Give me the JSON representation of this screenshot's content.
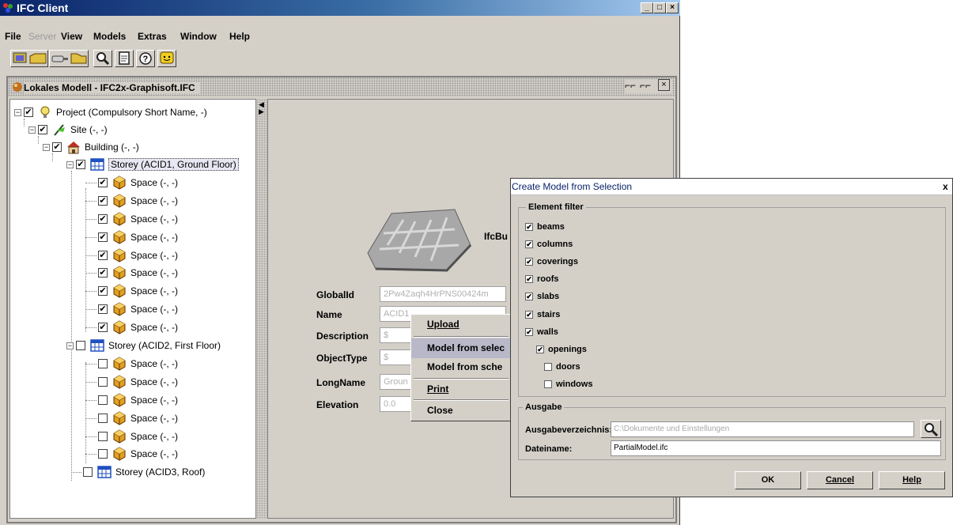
{
  "app": {
    "title": "IFC Client"
  },
  "menubar": [
    {
      "label": "File",
      "disabled": false
    },
    {
      "label": "Server",
      "disabled": true
    },
    {
      "label": "View",
      "disabled": false
    },
    {
      "label": "Models",
      "disabled": false
    },
    {
      "label": "Extras",
      "disabled": false
    },
    {
      "label": "Window",
      "disabled": false
    },
    {
      "label": "Help",
      "disabled": false
    }
  ],
  "toolbar": {
    "buttons": [
      "open-model-icon",
      "connect-icon",
      "search-icon",
      "document-icon",
      "help-icon",
      "chat-icon"
    ]
  },
  "frame": {
    "title": "Lokales Modell - IFC2x-Graphisoft.IFC"
  },
  "tree": [
    {
      "label": "Project (Compulsory Short Name, -)",
      "checked": true
    },
    {
      "label": "Site (-, -)",
      "checked": true
    },
    {
      "label": "Building (-, -)",
      "checked": true
    },
    {
      "label": "Storey (ACID1, Ground Floor)",
      "checked": true
    },
    {
      "label": "Space (-, -)",
      "checked": true
    },
    {
      "label": "Space (-, -)",
      "checked": true
    },
    {
      "label": "Space (-, -)",
      "checked": true
    },
    {
      "label": "Space (-, -)",
      "checked": true
    },
    {
      "label": "Space (-, -)",
      "checked": true
    },
    {
      "label": "Space (-, -)",
      "checked": true
    },
    {
      "label": "Space (-, -)",
      "checked": true
    },
    {
      "label": "Space (-, -)",
      "checked": true
    },
    {
      "label": "Space (-, -)",
      "checked": true
    },
    {
      "label": "Storey (ACID2, First Floor)",
      "checked": false
    },
    {
      "label": "Space (-, -)",
      "checked": false
    },
    {
      "label": "Space (-, -)",
      "checked": false
    },
    {
      "label": "Space (-, -)",
      "checked": false
    },
    {
      "label": "Space (-, -)",
      "checked": false
    },
    {
      "label": "Space (-, -)",
      "checked": false
    },
    {
      "label": "Space (-, -)",
      "checked": false
    },
    {
      "label": "Storey (ACID3, Roof)",
      "checked": false
    }
  ],
  "properties": {
    "entity_type": "IfcBu",
    "fields": [
      {
        "label": "GlobalId",
        "value": "2Pw4Zaqh4HrPNS00424m"
      },
      {
        "label": "Name",
        "value": "ACID1"
      },
      {
        "label": "Description",
        "value": "$"
      },
      {
        "label": "ObjectType",
        "value": "$"
      },
      {
        "label": "LongName",
        "value": "Groun"
      },
      {
        "label": "Elevation",
        "value": "0.0"
      }
    ]
  },
  "context_menu": [
    {
      "label": "Upload"
    },
    {
      "label": "Model from selec"
    },
    {
      "label": "Model from sche"
    },
    {
      "label": "Print"
    },
    {
      "label": "Close"
    }
  ],
  "dialog": {
    "title": "Create Model from Selection",
    "close_glyph": "x",
    "element_filter": {
      "title": "Element filter",
      "items": [
        {
          "label": "beams",
          "checked": true
        },
        {
          "label": "columns",
          "checked": true
        },
        {
          "label": "coverings",
          "checked": true
        },
        {
          "label": "roofs",
          "checked": true
        },
        {
          "label": "slabs",
          "checked": true
        },
        {
          "label": "stairs",
          "checked": true
        },
        {
          "label": "walls",
          "checked": true
        },
        {
          "label": "openings",
          "checked": true
        },
        {
          "label": "doors",
          "checked": false
        },
        {
          "label": "windows",
          "checked": false
        }
      ]
    },
    "output": {
      "title": "Ausgabe",
      "dir_label": "Ausgabeverzeichnis:",
      "dir_value": "C:\\Dokumente und Einstellungen",
      "file_label": "Dateiname:",
      "file_value": "PartialModel.ifc"
    },
    "buttons": {
      "ok": "OK",
      "cancel": "Cancel",
      "help": "Help"
    }
  }
}
